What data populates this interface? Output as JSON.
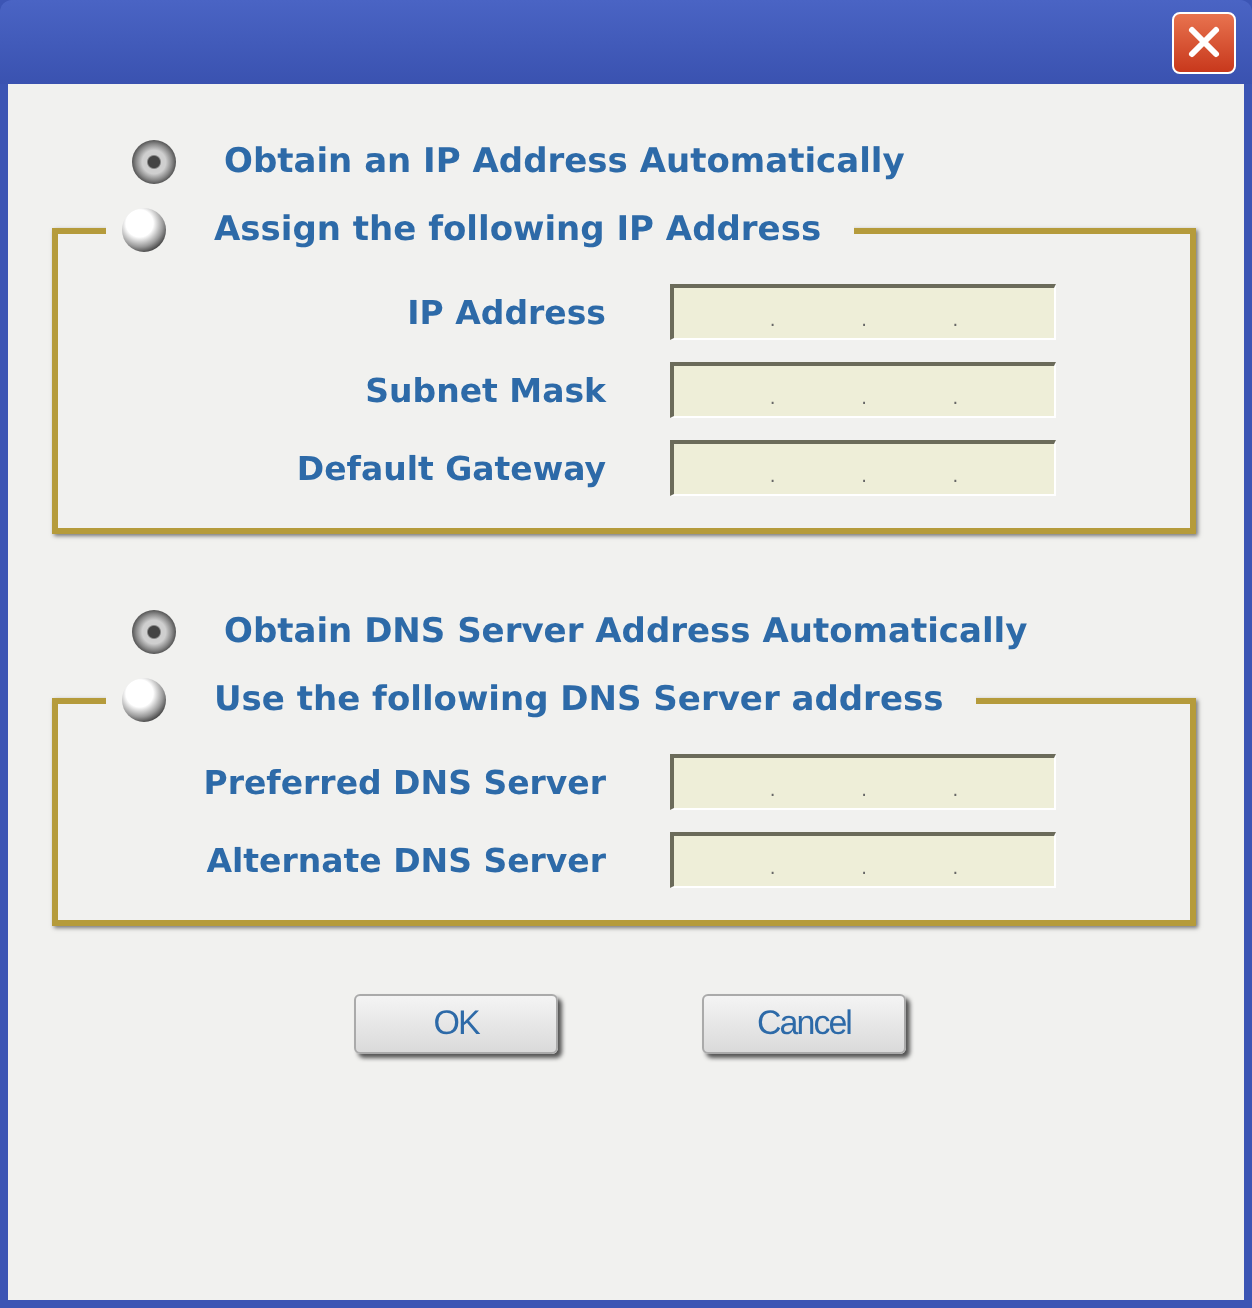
{
  "sections": [
    {
      "options": [
        {
          "label": "Obtain an IP Address Automatically",
          "selected": true
        },
        {
          "label": "Assign the following IP Address",
          "selected": false
        }
      ],
      "fields": [
        {
          "label": "IP Address",
          "value": ". . ."
        },
        {
          "label": "Subnet Mask",
          "value": ". . ."
        },
        {
          "label": "Default Gateway",
          "value": ". . ."
        }
      ]
    },
    {
      "options": [
        {
          "label": "Obtain DNS Server Address Automatically",
          "selected": true
        },
        {
          "label": "Use the following DNS Server address",
          "selected": false
        }
      ],
      "fields": [
        {
          "label": "Preferred DNS Server",
          "value": ". . ."
        },
        {
          "label": "Alternate DNS Server",
          "value": ". . ."
        }
      ]
    }
  ],
  "buttons": [
    "OK",
    "Cancel"
  ]
}
